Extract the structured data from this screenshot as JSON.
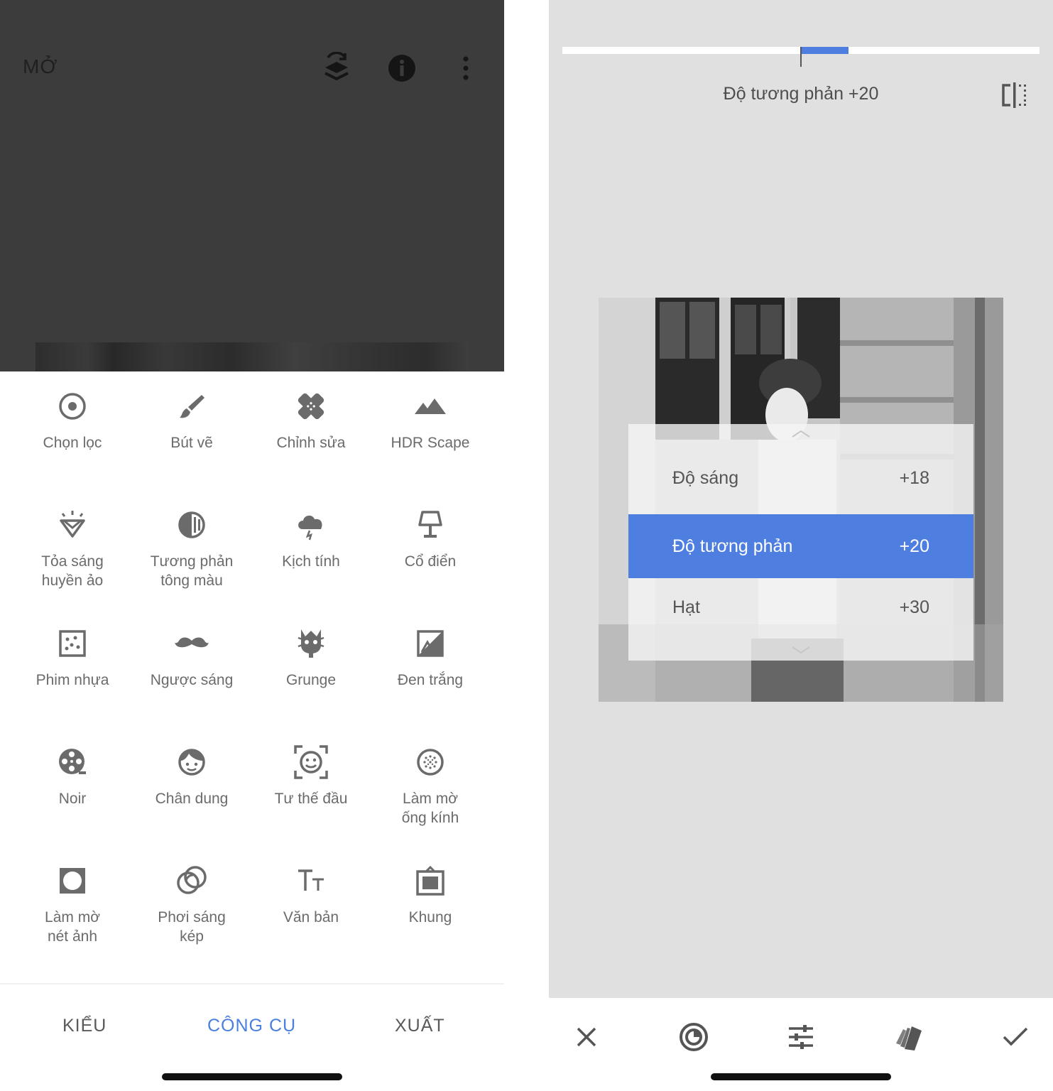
{
  "left": {
    "header": {
      "open_label": "MỞ"
    },
    "tools": [
      {
        "label": "Chọn lọc",
        "icon": "selective-icon"
      },
      {
        "label": "Bút vẽ",
        "icon": "brush-icon"
      },
      {
        "label": "Chỉnh sửa",
        "icon": "healing-icon"
      },
      {
        "label": "HDR Scape",
        "icon": "hdr-mountains-icon"
      },
      {
        "label": "Tỏa sáng\nhuyền ảo",
        "icon": "glamour-glow-icon"
      },
      {
        "label": "Tương phản\ntông màu",
        "icon": "tonal-contrast-icon"
      },
      {
        "label": "Kịch tính",
        "icon": "drama-cloud-icon"
      },
      {
        "label": "Cổ điển",
        "icon": "vintage-lamp-icon"
      },
      {
        "label": "Phim nhựa",
        "icon": "grainy-film-icon"
      },
      {
        "label": "Ngược sáng",
        "icon": "retrolux-mustache-icon"
      },
      {
        "label": "Grunge",
        "icon": "grunge-icon"
      },
      {
        "label": "Đen trắng",
        "icon": "black-white-icon"
      },
      {
        "label": "Noir",
        "icon": "noir-reel-icon"
      },
      {
        "label": "Chân dung",
        "icon": "portrait-face-icon"
      },
      {
        "label": "Tư thế đầu",
        "icon": "head-pose-icon"
      },
      {
        "label": "Làm mờ\nống kính",
        "icon": "lens-blur-icon"
      },
      {
        "label": "Làm mờ\nnét ảnh",
        "icon": "vignette-icon"
      },
      {
        "label": "Phơi sáng\nkép",
        "icon": "double-exposure-icon"
      },
      {
        "label": "Văn bản",
        "icon": "text-icon"
      },
      {
        "label": "Khung",
        "icon": "frame-icon"
      }
    ],
    "tabs": [
      {
        "label": "KIỂU",
        "active": false
      },
      {
        "label": "CÔNG CỤ",
        "active": true
      },
      {
        "label": "XUẤT",
        "active": false
      }
    ]
  },
  "right": {
    "slider": {
      "value": 20,
      "min": -100,
      "max": 100
    },
    "title": "Độ tương phản +20",
    "menu": [
      {
        "label": "Độ sáng",
        "value": "+18",
        "selected": false
      },
      {
        "label": "Độ tương phản",
        "value": "+20",
        "selected": true
      },
      {
        "label": "Hạt",
        "value": "+30",
        "selected": false
      }
    ],
    "bottom_icons": [
      "close-icon",
      "stylize-icon",
      "adjust-sliders-icon",
      "style-cards-icon",
      "check-icon"
    ]
  },
  "colors": {
    "accent": "#4e7fe0",
    "dark_overlay": "#3c3c3c",
    "right_bg": "#e0e0e0"
  }
}
